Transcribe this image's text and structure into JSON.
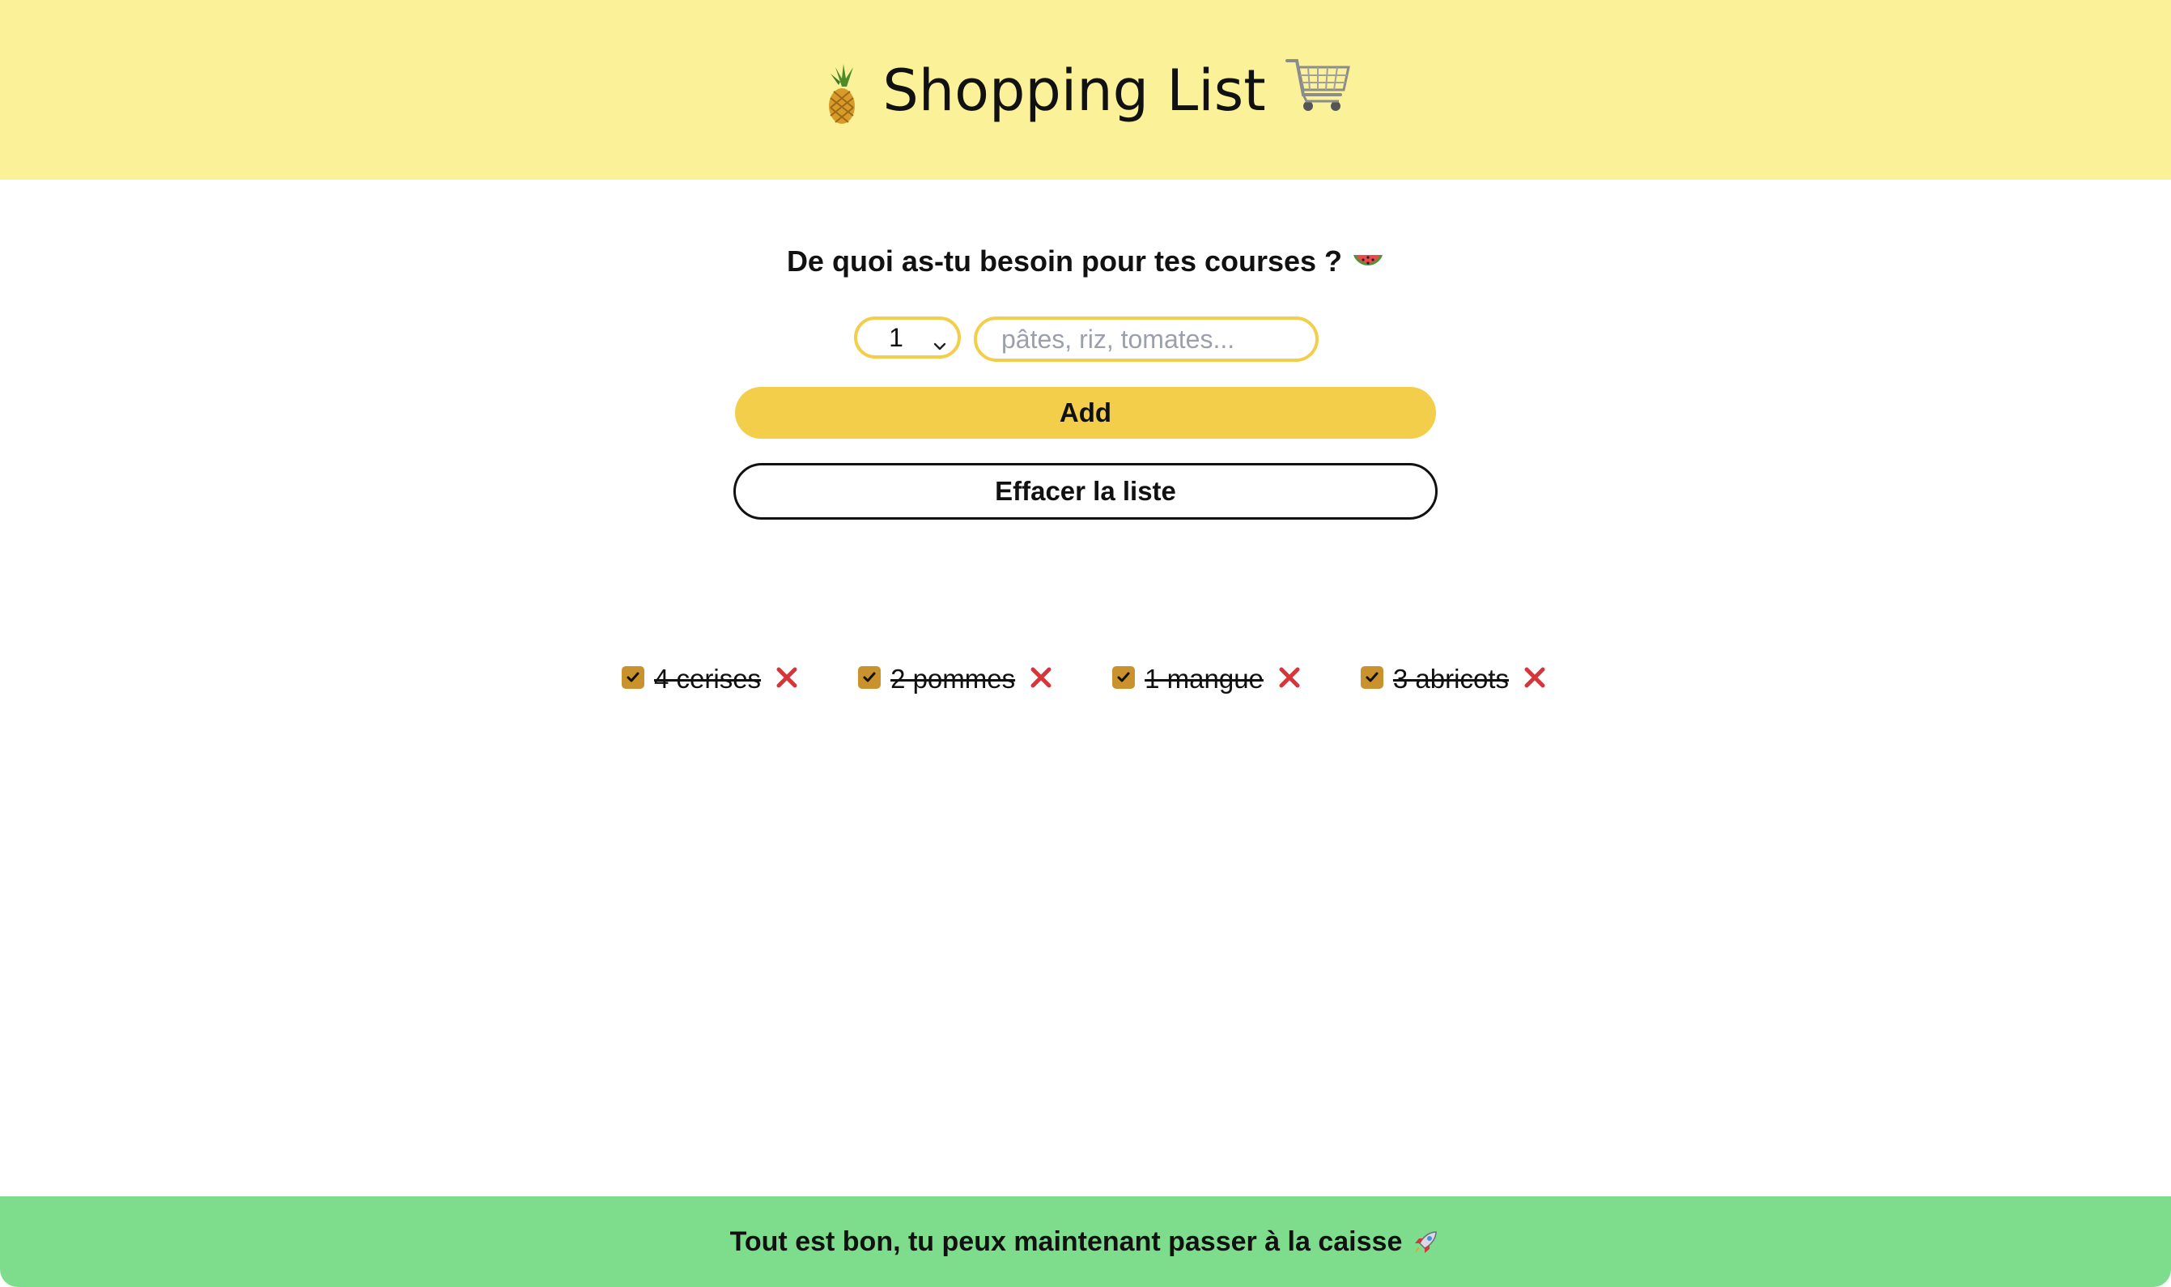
{
  "header": {
    "title": "Shopping List",
    "left_icon": "pineapple-icon",
    "right_icon": "shopping-cart-icon"
  },
  "form": {
    "question": "De quoi as-tu besoin pour tes courses ?",
    "question_icon": "watermelon-icon",
    "quantity_selected": "1",
    "item_placeholder": "pâtes, riz, tomates...",
    "item_value": "",
    "add_label": "Add",
    "clear_label": "Effacer la liste"
  },
  "items": [
    {
      "label": "4 cerises",
      "checked": true
    },
    {
      "label": "2 pommes",
      "checked": true
    },
    {
      "label": "1 mangue",
      "checked": true
    },
    {
      "label": "3 abricots",
      "checked": true
    }
  ],
  "footer": {
    "message": "Tout est bon, tu peux maintenant passer à la caisse",
    "icon": "rocket-icon"
  },
  "colors": {
    "header_bg": "#fbf198",
    "accent_yellow": "#f3ce4a",
    "checkbox": "#c9922d",
    "remove_red": "#d6363a",
    "footer_bg": "#7ddd8c"
  }
}
